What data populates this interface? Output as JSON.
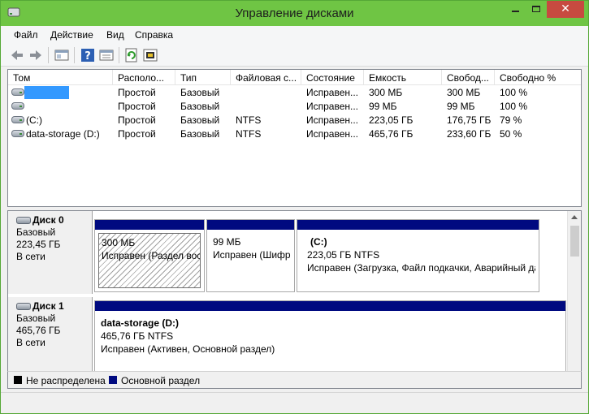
{
  "window": {
    "title": "Управление дисками",
    "colors": {
      "titlebar": "#6fc544",
      "close": "#c74a40",
      "partition_bar": "#000a80",
      "selection": "#3399ff"
    }
  },
  "menu": [
    "Файл",
    "Действие",
    "Вид",
    "Справка"
  ],
  "toolbar": {
    "icons": [
      "back-arrow-icon",
      "forward-arrow-icon",
      "console-tree-icon",
      "help-icon",
      "properties-icon",
      "refresh-icon",
      "settings-icon"
    ]
  },
  "volume_list": {
    "columns": [
      "Том",
      "Располо...",
      "Тип",
      "Файловая с...",
      "Состояние",
      "Емкость",
      "Свобод...",
      "Свободно %"
    ],
    "rows": [
      {
        "name": "",
        "layout": "Простой",
        "type": "Базовый",
        "fs": "",
        "status": "Исправен...",
        "capacity": "300 МБ",
        "free": "300 МБ",
        "free_pct": "100 %"
      },
      {
        "name": "",
        "layout": "Простой",
        "type": "Базовый",
        "fs": "",
        "status": "Исправен...",
        "capacity": "99 МБ",
        "free": "99 МБ",
        "free_pct": "100 %"
      },
      {
        "name": "(C:)",
        "layout": "Простой",
        "type": "Базовый",
        "fs": "NTFS",
        "status": "Исправен...",
        "capacity": "223,05 ГБ",
        "free": "176,75 ГБ",
        "free_pct": "79 %"
      },
      {
        "name": "data-storage (D:)",
        "layout": "Простой",
        "type": "Базовый",
        "fs": "NTFS",
        "status": "Исправен...",
        "capacity": "465,76 ГБ",
        "free": "233,60 ГБ",
        "free_pct": "50 %"
      }
    ]
  },
  "disks": [
    {
      "name": "Диск 0",
      "type": "Базовый",
      "size": "223,45 ГБ",
      "state": "В сети",
      "partitions": [
        {
          "title": "",
          "size": "300 МБ",
          "status": "Исправен (Раздел восстановления)"
        },
        {
          "title": "",
          "size": "99 МБ",
          "status": "Исправен (Шифрованный (EFI) системный раздел)"
        },
        {
          "title": "(C:)",
          "size": "223,05 ГБ NTFS",
          "status": "Исправен (Загрузка, Файл подкачки, Аварийный дамп памяти, Основной раздел)"
        }
      ]
    },
    {
      "name": "Диск 1",
      "type": "Базовый",
      "size": "465,76 ГБ",
      "state": "В сети",
      "partitions": [
        {
          "title": "data-storage  (D:)",
          "size": "465,76 ГБ NTFS",
          "status": "Исправен (Активен, Основной раздел)"
        }
      ]
    }
  ],
  "legend": [
    {
      "label": "Не распределена",
      "color": "#000000"
    },
    {
      "label": "Основной раздел",
      "color": "#000a80"
    }
  ]
}
